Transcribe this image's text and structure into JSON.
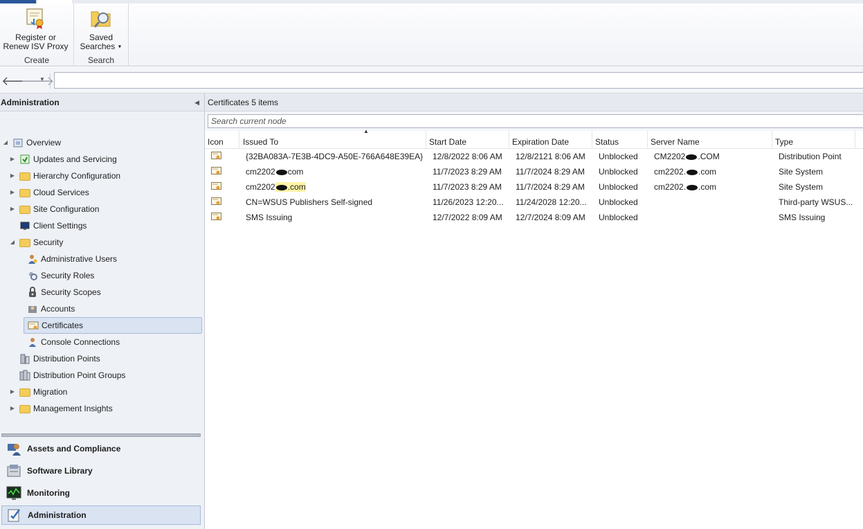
{
  "ribbon": {
    "groups": [
      {
        "label": "Create",
        "buttons": [
          {
            "label_line1": "Register or",
            "label_line2": "Renew ISV Proxy"
          }
        ]
      },
      {
        "label": "Search",
        "buttons": [
          {
            "label_line1": "Saved",
            "label_line2": "Searches"
          }
        ]
      }
    ]
  },
  "addressbar": {
    "value": ""
  },
  "navigation": {
    "header": "Administration",
    "tree": [
      {
        "label": "Overview"
      },
      {
        "label": "Updates and Servicing"
      },
      {
        "label": "Hierarchy Configuration"
      },
      {
        "label": "Cloud Services"
      },
      {
        "label": "Site Configuration"
      },
      {
        "label": "Client Settings"
      },
      {
        "label": "Security"
      },
      {
        "label": "Administrative Users"
      },
      {
        "label": "Security Roles"
      },
      {
        "label": "Security Scopes"
      },
      {
        "label": "Accounts"
      },
      {
        "label": "Certificates"
      },
      {
        "label": "Console Connections"
      },
      {
        "label": "Distribution Points"
      },
      {
        "label": "Distribution Point Groups"
      },
      {
        "label": "Migration"
      },
      {
        "label": "Management Insights"
      }
    ],
    "workspaces": [
      {
        "label": "Assets and Compliance"
      },
      {
        "label": "Software Library"
      },
      {
        "label": "Monitoring"
      },
      {
        "label": "Administration"
      }
    ]
  },
  "main": {
    "title": "Certificates 5 items",
    "search_placeholder": "Search current node",
    "columns": [
      "Icon",
      "Issued To",
      "Start Date",
      "Expiration Date",
      "Status",
      "Server Name",
      "Type"
    ],
    "rows": [
      {
        "issued_to": "{32BA083A-7E3B-4DC9-A50E-766A648E39EA}",
        "start": "12/8/2022 8:06 AM",
        "expiration": "12/8/2121 8:06 AM",
        "status": "Unblocked",
        "server_pre": "CM2202",
        "server_post": ".COM",
        "type": "Distribution Point"
      },
      {
        "issued_pre": "cm2202",
        "issued_post": "com",
        "start": "11/7/2023 8:29 AM",
        "expiration": "11/7/2024 8:29 AM",
        "status": "Unblocked",
        "server_pre": "cm2202.",
        "server_post": ".com",
        "type": "Site System"
      },
      {
        "issued_pre": "cm2202",
        "issued_post": ".com",
        "start": "11/7/2023 8:29 AM",
        "expiration": "11/7/2024 8:29 AM",
        "status": "Unblocked",
        "server_pre": "cm2202.",
        "server_post": ".com",
        "type": "Site System"
      },
      {
        "issued_to": "CN=WSUS Publishers Self-signed",
        "start": "11/26/2023 12:20...",
        "expiration": "11/24/2028 12:20...",
        "status": "Unblocked",
        "server": "",
        "type": "Third-party WSUS..."
      },
      {
        "issued_to": "SMS Issuing",
        "start": "12/7/2022 8:09 AM",
        "expiration": "12/7/2024 8:09 AM",
        "status": "Unblocked",
        "server": "",
        "type": "SMS Issuing"
      }
    ]
  }
}
